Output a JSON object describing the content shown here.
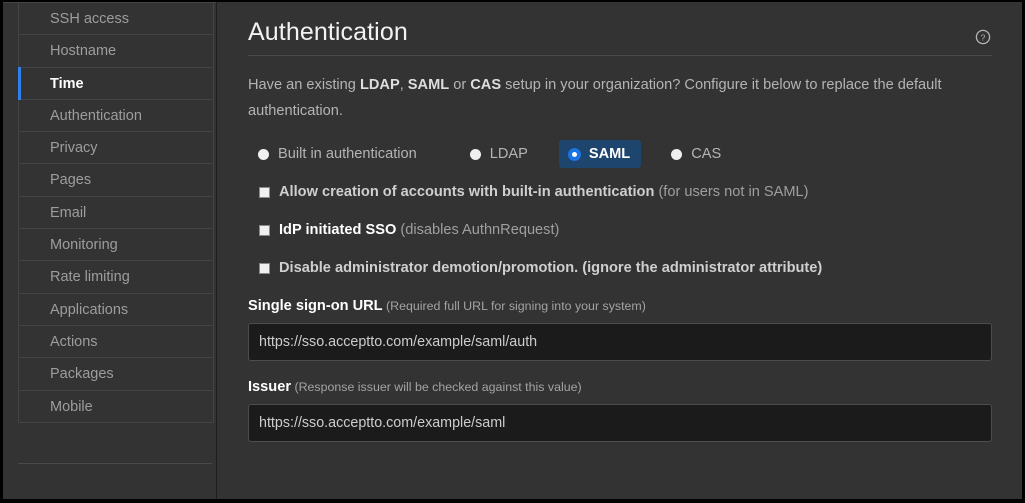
{
  "sidebar": {
    "items": [
      {
        "label": "SSH access",
        "active": false
      },
      {
        "label": "Hostname",
        "active": false
      },
      {
        "label": "Time",
        "active": true
      },
      {
        "label": "Authentication",
        "active": false
      },
      {
        "label": "Privacy",
        "active": false
      },
      {
        "label": "Pages",
        "active": false
      },
      {
        "label": "Email",
        "active": false
      },
      {
        "label": "Monitoring",
        "active": false
      },
      {
        "label": "Rate limiting",
        "active": false
      },
      {
        "label": "Applications",
        "active": false
      },
      {
        "label": "Actions",
        "active": false
      },
      {
        "label": "Packages",
        "active": false
      },
      {
        "label": "Mobile",
        "active": false
      }
    ]
  },
  "main": {
    "title": "Authentication",
    "help_icon": "help-circle-icon",
    "intro": {
      "part1": "Have an existing ",
      "b1": "LDAP",
      "part2": ", ",
      "b2": "SAML",
      "part3": " or ",
      "b3": "CAS",
      "part4": " setup in your organization? Configure it below to replace the default authentication."
    },
    "auth_modes": [
      {
        "label": "Built in authentication",
        "selected": false
      },
      {
        "label": "LDAP",
        "selected": false
      },
      {
        "label": "SAML",
        "selected": true
      },
      {
        "label": "CAS",
        "selected": false
      }
    ],
    "checkboxes": [
      {
        "label": "Allow creation of accounts with built-in authentication",
        "hint": " (for users not in SAML)",
        "checked": false
      },
      {
        "label": "IdP initiated SSO",
        "hint": " (disables AuthnRequest)",
        "checked": false
      },
      {
        "label": "Disable administrator demotion/promotion. (ignore the administrator attribute)",
        "hint": "",
        "checked": false
      }
    ],
    "fields": [
      {
        "label": "Single sign-on URL",
        "hint": " (Required full URL for signing into your system)",
        "value": "https://sso.acceptto.com/example/saml/auth",
        "placeholder": "https://"
      },
      {
        "label": "Issuer",
        "hint": " (Response issuer will be checked against this value)",
        "value": "https://sso.acceptto.com/example/saml",
        "placeholder": "https://"
      }
    ]
  },
  "colors": {
    "accent": "#2f80ed",
    "selected_bg": "#1e456e",
    "panel_bg": "#333333",
    "input_bg": "#1b1b1b"
  }
}
